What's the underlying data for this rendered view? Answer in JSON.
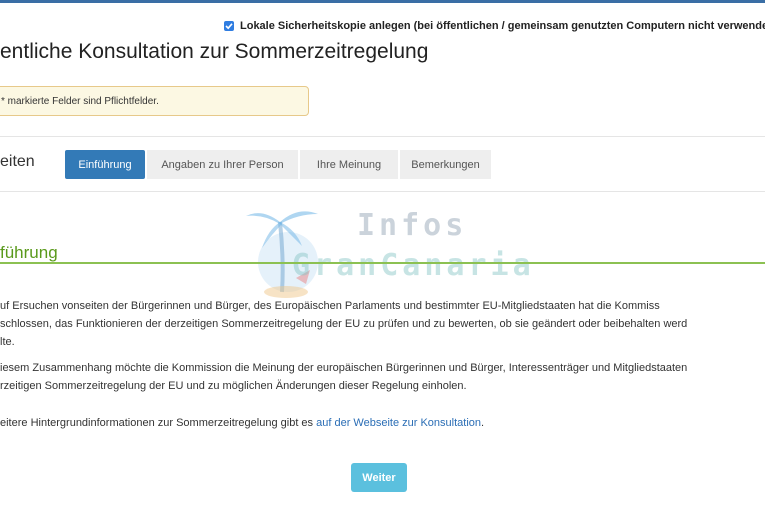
{
  "header": {
    "local_backup_checked": true,
    "local_backup_label": "Lokale Sicherheitskopie anlegen (bei öffentlichen / gemeinsam genutzten Computern nicht verwende"
  },
  "page": {
    "title": "entliche Konsultation zur Sommerzeitregelung",
    "required_notice": "* markierte Felder sind Pflichtfelder."
  },
  "steps": {
    "label": "eiten",
    "tabs": [
      {
        "label": "Einführung",
        "active": true
      },
      {
        "label": "Angaben zu Ihrer Person",
        "active": false
      },
      {
        "label": "Ihre Meinung",
        "active": false
      },
      {
        "label": "Bemerkungen",
        "active": false
      }
    ]
  },
  "watermark": {
    "line1": "Infos",
    "line2": "GranCanaria"
  },
  "section": {
    "title": "führung",
    "paragraphs": [
      [
        "uf Ersuchen vonseiten der Bürgerinnen und Bürger, des Europäischen Parlaments und bestimmter EU-Mitgliedstaaten hat die Kommiss",
        "schlossen, das Funktionieren der derzeitigen Sommerzeitregelung der EU zu prüfen und zu bewerten, ob sie geändert oder beibehalten werd",
        "lte."
      ],
      [
        "iesem Zusammenhang möchte die Kommission die Meinung der europäischen Bürgerinnen und Bürger, Interessenträger und Mitgliedstaaten",
        "rzeitigen Sommerzeitregelung der EU und zu möglichen Änderungen dieser Regelung einholen."
      ]
    ],
    "info_prefix": "eitere Hintergrundinformationen zur Sommerzeitregelung gibt es ",
    "info_link": "auf der Webseite zur Konsultation",
    "info_suffix": "."
  },
  "actions": {
    "next_label": "Weiter"
  },
  "colors": {
    "primary": "#337ab7",
    "next_button": "#5bc0de",
    "section_green": "#5a9a1c",
    "notice_bg": "#fcf8e3"
  }
}
